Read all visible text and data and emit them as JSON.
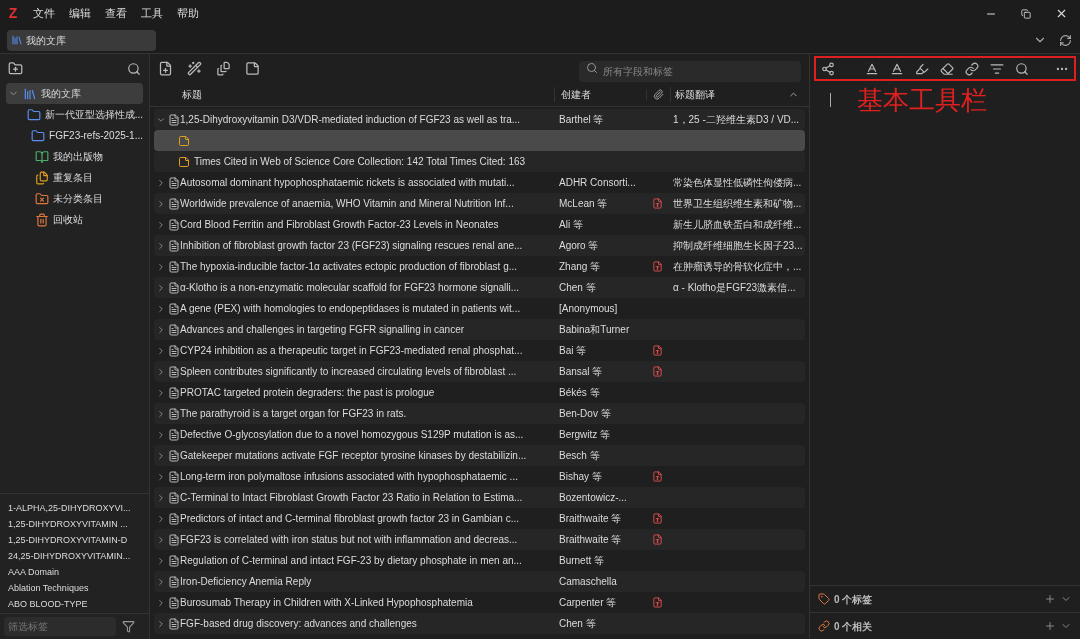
{
  "app": {
    "logo": "Z",
    "menu": [
      "文件",
      "编辑",
      "查看",
      "工具",
      "帮助"
    ]
  },
  "tabs": [
    {
      "label": "我的文库",
      "selected": true
    }
  ],
  "sidebar": {
    "collections": [
      {
        "label": "我的文库",
        "kind": "library",
        "selected": true,
        "expanded": true,
        "children": [
          {
            "label": "新一代亚型选择性成...",
            "kind": "folder",
            "selected": false
          },
          {
            "label": "FGF23-refs-2025-1...",
            "kind": "folder",
            "selected": false
          },
          {
            "label": "我的出版物",
            "kind": "publications",
            "selected": false
          },
          {
            "label": "重复条目",
            "kind": "duplicates",
            "selected": false
          },
          {
            "label": "未分类条目",
            "kind": "unfiled",
            "selected": false
          },
          {
            "label": "回收站",
            "kind": "trash",
            "selected": false
          }
        ]
      }
    ],
    "tags": [
      "1-ALPHA,25-DIHYDROXYVI...",
      "1,25-DIHYDROXYVITAMIN ...",
      "1,25-DIHYDROXYVITAMIN-D",
      "24,25-DIHYDROXYVITAMIN...",
      "AAA Domain",
      "Ablation Techniques",
      "ABO BLOOD-TYPE"
    ],
    "tag_filter": {
      "placeholder": "筛选标签"
    }
  },
  "search": {
    "placeholder": "所有字段和标签"
  },
  "table": {
    "columns": [
      "标题",
      "创建者",
      "标题翻译"
    ],
    "rows": [
      {
        "kind": "item",
        "expanded": true,
        "selected": false,
        "title": "1,25-Dihydroxyvitamin D3/VDR-mediated induction of FGF23 as well as tra...",
        "creator": "Barthel 等",
        "attachment": false,
        "translation": "1，25 -二羟维生素D3 / VD..."
      },
      {
        "kind": "note",
        "selected": true,
        "title": ""
      },
      {
        "kind": "note",
        "selected": false,
        "title": "Times Cited in Web of Science Core Collection:  142 Total Times Cited:  163"
      },
      {
        "kind": "item",
        "expanded": false,
        "selected": false,
        "title": "Autosomal dominant hypophosphataemic rickets is associated with mutati...",
        "creator": "ADHR Consorti...",
        "attachment": false,
        "translation": "常染色体显性低磷性佝偻病..."
      },
      {
        "kind": "item",
        "expanded": false,
        "selected": false,
        "title": "Worldwide prevalence of anaemia, WHO Vitamin and Mineral Nutrition Inf...",
        "creator": "McLean 等",
        "attachment": true,
        "translation": "世界卫生组织维生素和矿物..."
      },
      {
        "kind": "item",
        "expanded": false,
        "selected": false,
        "title": "Cord Blood Ferritin and Fibroblast Growth Factor-23 Levels in Neonates",
        "creator": "Ali 等",
        "attachment": false,
        "translation": "新生儿脐血铁蛋白和成纤维..."
      },
      {
        "kind": "item",
        "expanded": false,
        "selected": false,
        "title": "Inhibition of fibroblast growth factor 23 (FGF23) signaling rescues renal ane...",
        "creator": "Agoro 等",
        "attachment": false,
        "translation": "抑制成纤维细胞生长因子23..."
      },
      {
        "kind": "item",
        "expanded": false,
        "selected": false,
        "title": "The hypoxia-inducible factor-1α activates ectopic production of fibroblast g...",
        "creator": "Zhang 等",
        "attachment": true,
        "translation": "在肿瘤诱导的骨软化症中，..."
      },
      {
        "kind": "item",
        "expanded": false,
        "selected": false,
        "title": "α-Klotho is a non-enzymatic molecular scaffold for FGF23 hormone signalli...",
        "creator": "Chen 等",
        "attachment": false,
        "translation": "α - Klotho是FGF23激素信..."
      },
      {
        "kind": "item",
        "expanded": false,
        "selected": false,
        "title": "A gene (PEX) with homologies to endopeptidases is mutated in patients wit...",
        "creator": "[Anonymous]",
        "attachment": false
      },
      {
        "kind": "item",
        "expanded": false,
        "selected": false,
        "title": "Advances and challenges in targeting FGFR signalling in cancer",
        "creator": "Babina和Turner",
        "attachment": false
      },
      {
        "kind": "item",
        "expanded": false,
        "selected": false,
        "title": "CYP24 inhibition as a therapeutic target in FGF23-mediated renal phosphat...",
        "creator": "Bai 等",
        "attachment": true
      },
      {
        "kind": "item",
        "expanded": false,
        "selected": false,
        "title": "Spleen contributes significantly to increased circulating levels of fibroblast ...",
        "creator": "Bansal 等",
        "attachment": true
      },
      {
        "kind": "item",
        "expanded": false,
        "selected": false,
        "title": "PROTAC targeted protein degraders: the past is prologue",
        "creator": "Békés 等",
        "attachment": false
      },
      {
        "kind": "item",
        "expanded": false,
        "selected": false,
        "title": "The parathyroid is a target organ for FGF23 in rats.",
        "creator": "Ben-Dov 等",
        "attachment": false
      },
      {
        "kind": "item",
        "expanded": false,
        "selected": false,
        "title": "Defective O-glycosylation due to a novel homozygous S129P mutation is as...",
        "creator": "Bergwitz 等",
        "attachment": false
      },
      {
        "kind": "item",
        "expanded": false,
        "selected": false,
        "title": "Gatekeeper mutations activate FGF receptor tyrosine kinases by destabilizin...",
        "creator": "Besch 等",
        "attachment": false
      },
      {
        "kind": "item",
        "expanded": false,
        "selected": false,
        "title": "Long-term iron polymaltose infusions associated with hypophosphataemic ...",
        "creator": "Bishay 等",
        "attachment": true
      },
      {
        "kind": "item",
        "expanded": false,
        "selected": false,
        "title": "C-Terminal to Intact Fibroblast Growth Factor 23 Ratio in Relation to Estima...",
        "creator": "Bozentowicz-...",
        "attachment": false
      },
      {
        "kind": "item",
        "expanded": false,
        "selected": false,
        "title": "Predictors of intact and C-terminal fibroblast growth factor 23 in Gambian c...",
        "creator": "Braithwaite 等",
        "attachment": true
      },
      {
        "kind": "item",
        "expanded": false,
        "selected": false,
        "title": "FGF23 is correlated with iron status but not with inflammation and decreas...",
        "creator": "Braithwaite 等",
        "attachment": true
      },
      {
        "kind": "item",
        "expanded": false,
        "selected": false,
        "title": "Regulation of C-terminal and intact FGF-23 by dietary phosphate in men an...",
        "creator": "Burnett 等",
        "attachment": false
      },
      {
        "kind": "item",
        "expanded": false,
        "selected": false,
        "title": "Iron-Deficiency Anemia Reply",
        "creator": "Camaschella",
        "attachment": false
      },
      {
        "kind": "item",
        "expanded": false,
        "selected": false,
        "title": "Burosumab Therapy in Children with X-Linked Hypophosphatemia",
        "creator": "Carpenter 等",
        "attachment": true
      },
      {
        "kind": "item",
        "expanded": false,
        "selected": false,
        "title": "FGF-based drug discovery: advances and challenges",
        "creator": "Chen 等",
        "attachment": false
      }
    ]
  },
  "annotation": {
    "text": "基本工具栏"
  },
  "item_pane": {
    "sections": [
      {
        "kind": "tags",
        "label": "0 个标签"
      },
      {
        "kind": "related",
        "label": "0 个相关"
      }
    ]
  }
}
